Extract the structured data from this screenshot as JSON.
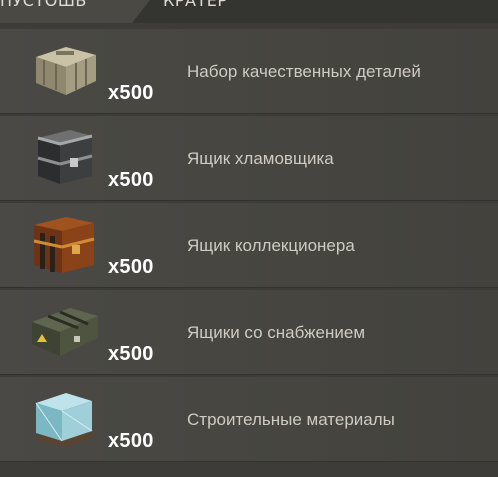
{
  "tabs": [
    {
      "label": "ПУСТОШЬ",
      "active": true
    },
    {
      "label": "КРАТЕР",
      "active": false
    }
  ],
  "items": [
    {
      "icon": "toolbox-crate-icon",
      "qty": "x500",
      "label": "Набор качественных деталей"
    },
    {
      "icon": "scavenger-chest-icon",
      "qty": "x500",
      "label": "Ящик хламовщика"
    },
    {
      "icon": "collector-chest-icon",
      "qty": "x500",
      "label": "Ящик коллекционера"
    },
    {
      "icon": "supply-crate-icon",
      "qty": "x500",
      "label": "Ящики со снабжением"
    },
    {
      "icon": "building-materials-icon",
      "qty": "x500",
      "label": "Строительные материалы"
    }
  ],
  "colors": {
    "background": "#3d3c38",
    "row": "#4a4945",
    "qty_text": "#ffffff",
    "label_text": "#cfcbc3"
  }
}
